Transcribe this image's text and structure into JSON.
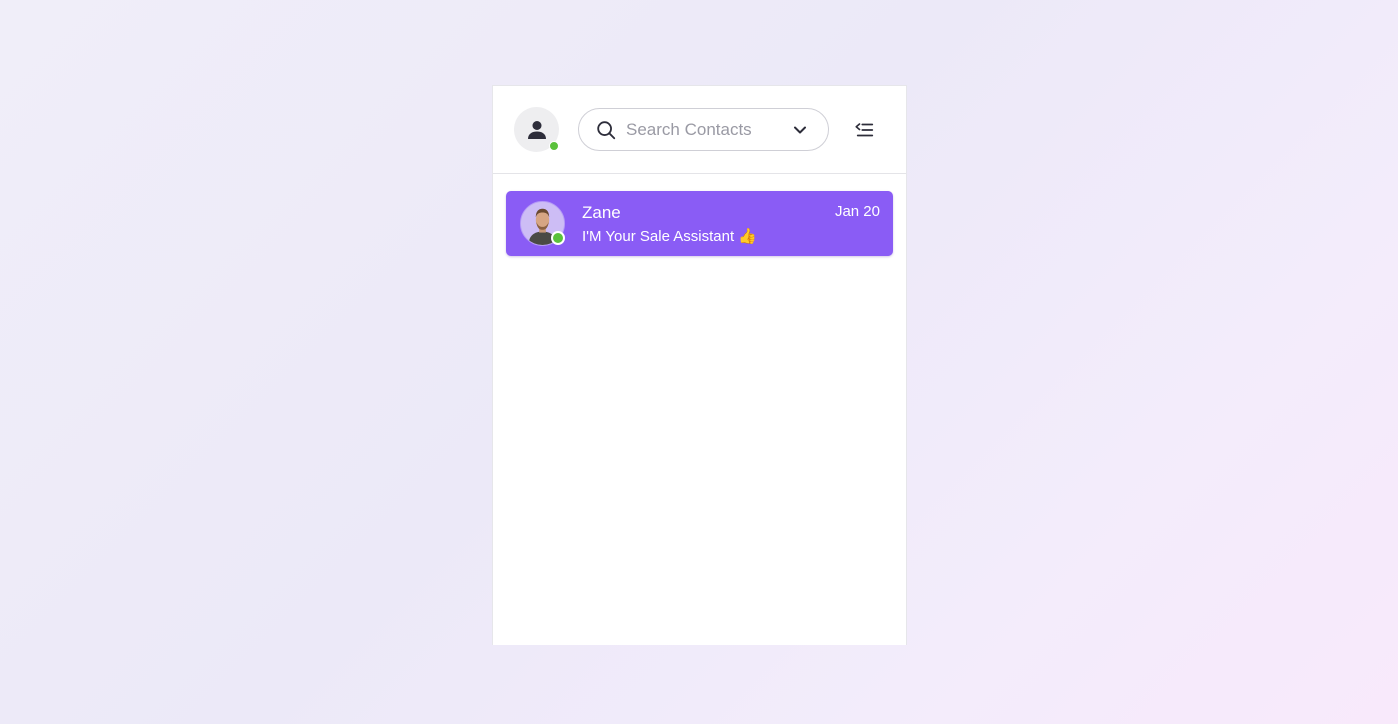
{
  "header": {
    "user_status": "online",
    "search": {
      "placeholder": "Search Contacts",
      "value": ""
    }
  },
  "contacts": [
    {
      "name": "Zane",
      "message": "I'M Your Sale Assistant 👍",
      "date": "Jan 20",
      "status": "online",
      "selected": true
    }
  ],
  "colors": {
    "accent": "#8a5cf5",
    "online": "#5ac13b"
  }
}
